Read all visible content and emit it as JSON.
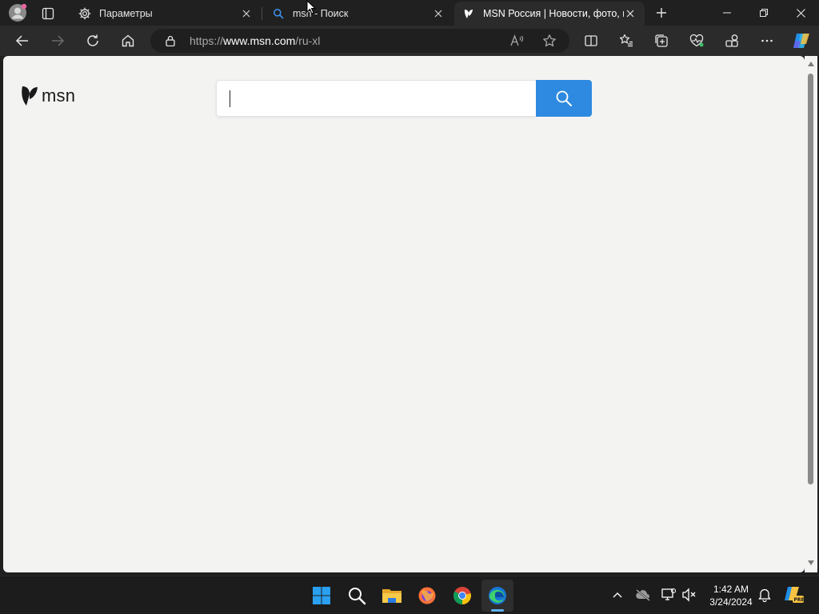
{
  "browser": {
    "tabs": [
      {
        "title": "Параметры",
        "icon": "gear-icon",
        "active": false
      },
      {
        "title": "msn - Поиск",
        "icon": "search-icon",
        "active": false
      },
      {
        "title": "MSN Россия | Новости, фото, погода",
        "icon": "msn-butterfly-icon",
        "active": true
      }
    ],
    "address": {
      "protocol": "https://",
      "host": "www.msn.com",
      "path": "/ru-xl"
    }
  },
  "page": {
    "logo_text": "msn",
    "search": {
      "value": "",
      "placeholder": ""
    }
  },
  "taskbar": {
    "apps": [
      "windows-start-icon",
      "search-icon",
      "file-explorer-icon",
      "firefox-icon",
      "chrome-icon",
      "edge-icon"
    ],
    "clock": {
      "time": "1:42 AM",
      "date": "3/24/2024"
    }
  },
  "colors": {
    "accent": "#2e8ae0",
    "content_bg": "#f3f3f2",
    "chrome_dark": "#202020"
  }
}
